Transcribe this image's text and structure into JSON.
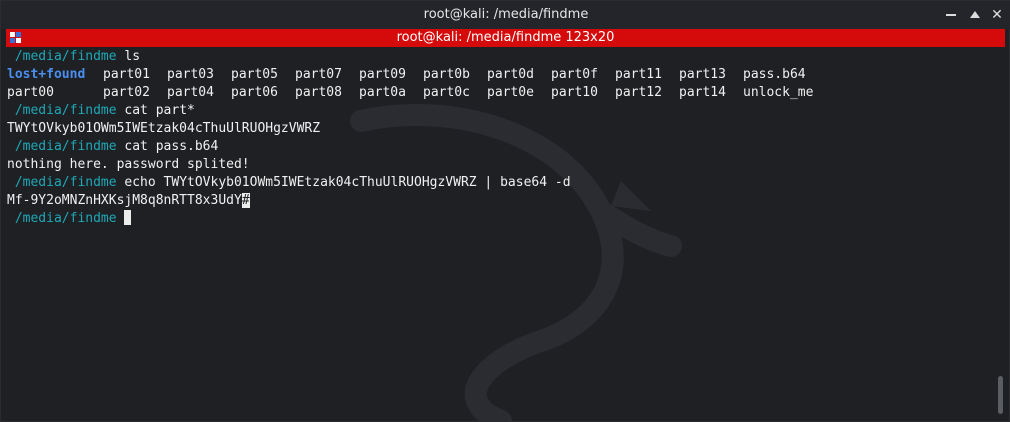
{
  "window": {
    "title": "root@kali: /media/findme",
    "tab_title": "root@kali: /media/findme 123x20",
    "buttons": {
      "minimize": "minimize",
      "maximize": "maximize",
      "close": "✕"
    }
  },
  "terminal": {
    "prompt_path": " /media/findme",
    "commands": {
      "ls": " ls",
      "cat_parts": " cat part*",
      "cat_b64": " cat pass.b64",
      "echo": " echo TWYtOVkyb01OWm5IWEtzak04cThuUlRUOHgzVWRZ | base64 -d"
    },
    "ls_row1": [
      "lost+found",
      "part01",
      "part03",
      "part05",
      "part07",
      "part09",
      "part0b",
      "part0d",
      "part0f",
      "part11",
      "part13",
      "pass.b64"
    ],
    "ls_row2": [
      "part00",
      "part02",
      "part04",
      "part06",
      "part08",
      "part0a",
      "part0c",
      "part0e",
      "part10",
      "part12",
      "part14",
      "unlock_me"
    ],
    "output_parts": "TWYtOVkyb01OWm5IWEtzak04cThuUlRUOHgzVWRZ",
    "output_b64": "nothing here. password splited!",
    "decoded": "Mf-9Y2oMNZnHXKsjM8q8nRTT8x3UdY",
    "decoded_cursor": "#"
  },
  "colors": {
    "tab_bar": "#d50a0a",
    "prompt": "#1fa8b6",
    "directory": "#4a8ff0",
    "background": "#1e2024"
  },
  "icons": {
    "terminal": "terminal-icon",
    "watermark": "kali-dragon-icon"
  }
}
